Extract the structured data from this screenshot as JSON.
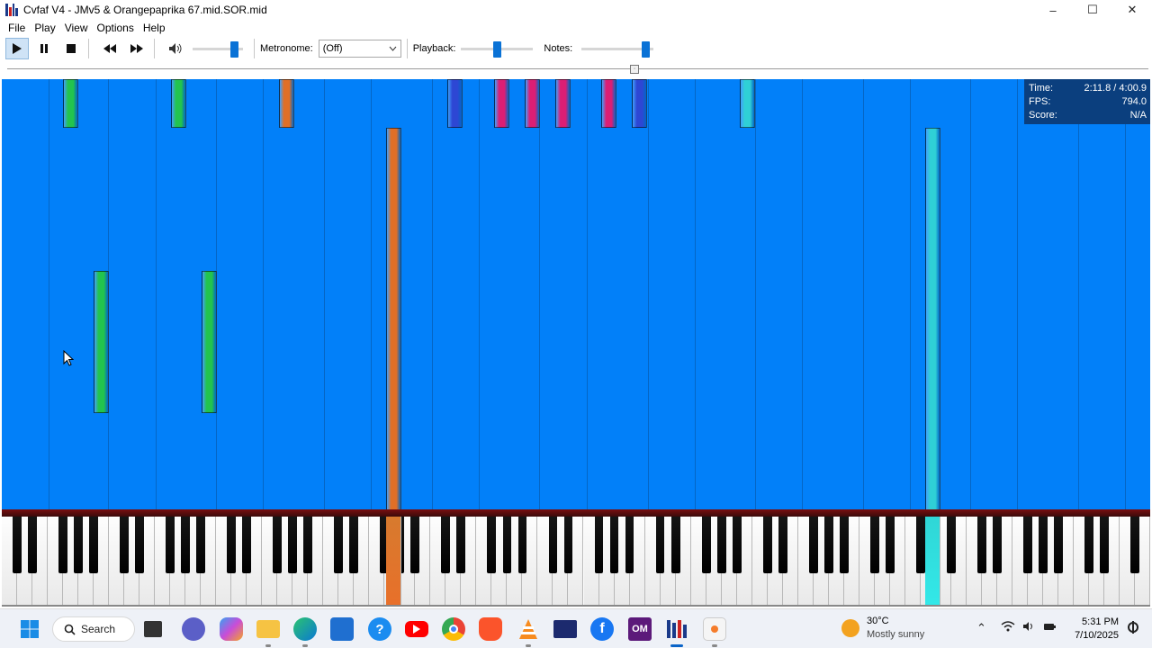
{
  "window": {
    "title": "Cvfaf V4 - JMv5 & Orangepaprika 67.mid.SOR.mid",
    "minimize": "–",
    "maximize": "☐",
    "close": "✕"
  },
  "menu": [
    "File",
    "Play",
    "View",
    "Options",
    "Help"
  ],
  "toolbar": {
    "metronome_label": "Metronome:",
    "metronome_value": "(Off)",
    "playback_label": "Playback:",
    "notes_label": "Notes:",
    "volume_level": 0.9,
    "playback_level": 0.5,
    "notes_level": 0.95
  },
  "seek": {
    "position": 0.55
  },
  "stats": {
    "time_label": "Time:",
    "time_value": "2:11.8 / 4:00.9",
    "fps_label": "FPS:",
    "fps_value": "794.0",
    "score_label": "Score:",
    "score_value": "N/A"
  },
  "colors": {
    "background": "#0280f9",
    "green": "#22c44e",
    "orange": "#e06f27",
    "blue": "#2d47d4",
    "pink": "#dc1e74",
    "cyan": "#2fd0d6"
  },
  "taskbar": {
    "search_label": "Search",
    "weather_temp": "30°C",
    "weather_desc": "Mostly sunny",
    "time": "5:31 PM",
    "date": "7/10/2025"
  },
  "icons": [
    "windows-start-icon",
    "search-icon",
    "file-explorer-icon",
    "teams-icon",
    "copilot-icon",
    "folder-icon",
    "edge-icon",
    "store-icon",
    "help-icon",
    "youtube-icon",
    "chrome-icon",
    "brave-icon",
    "vlc-icon",
    "terminal-icon",
    "facebook-icon",
    "om-icon",
    "piano-app-icon",
    "paint-icon"
  ]
}
